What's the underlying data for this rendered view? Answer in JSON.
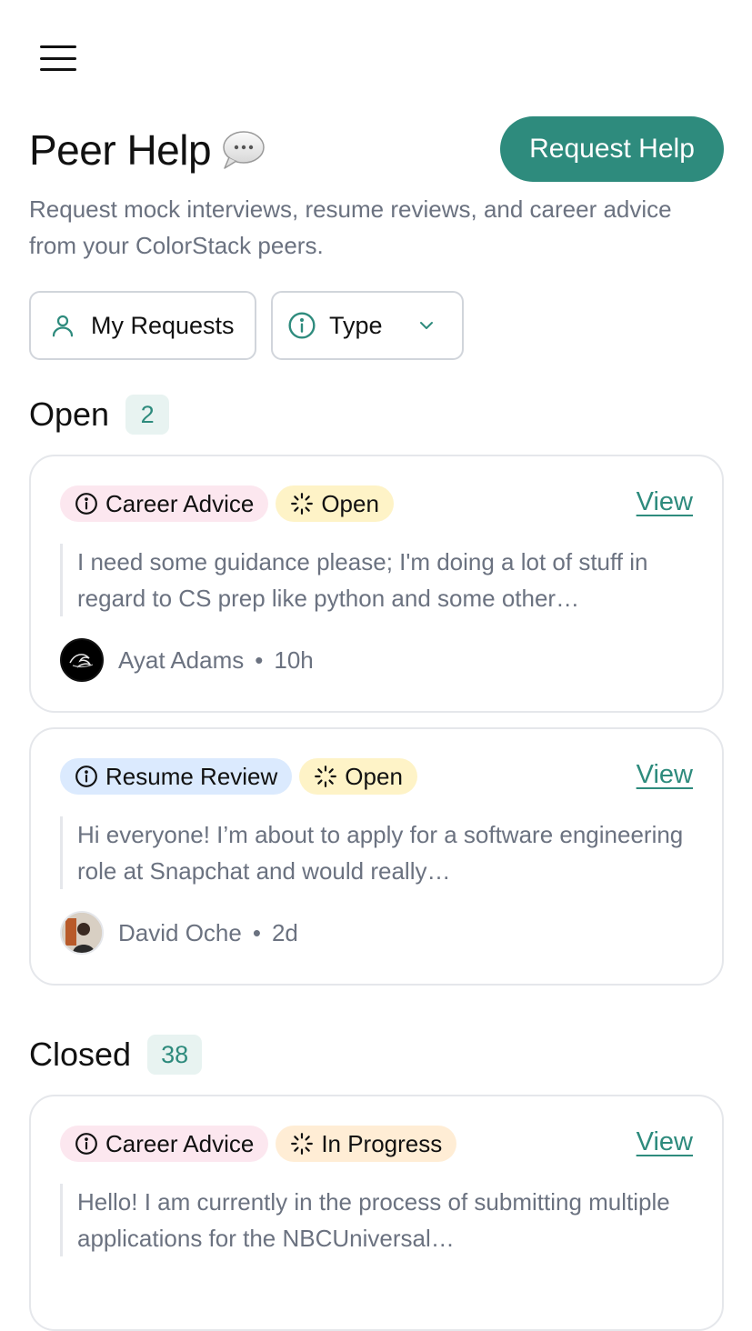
{
  "header": {
    "title": "Peer Help",
    "request_button": "Request Help",
    "subtitle": "Request mock interviews, resume reviews, and career advice from your ColorStack peers."
  },
  "filters": {
    "my_requests": "My Requests",
    "type": "Type"
  },
  "sections": {
    "open": {
      "title": "Open",
      "count": "2"
    },
    "closed": {
      "title": "Closed",
      "count": "38"
    }
  },
  "cards": [
    {
      "type_tag": "Career Advice",
      "status_tag": "Open",
      "view_label": "View",
      "description": "I need some guidance please; I'm doing a lot of stuff in regard to CS prep like python and some other…",
      "author": "Ayat Adams",
      "separator": "•",
      "time": "10h"
    },
    {
      "type_tag": "Resume Review",
      "status_tag": "Open",
      "view_label": "View",
      "description": "Hi everyone! I’m about to apply for a software engineering role at Snapchat and would really…",
      "author": "David Oche",
      "separator": "•",
      "time": "2d"
    },
    {
      "type_tag": "Career Advice",
      "status_tag": "In Progress",
      "view_label": "View",
      "description": "Hello! I am currently in the process of submitting multiple applications for the NBCUniversal…"
    }
  ],
  "colors": {
    "accent": "#2e8b7d",
    "tag_career": "#fce7ef",
    "tag_resume": "#dbeafe",
    "tag_open": "#fef3c7",
    "tag_in_progress": "#ffedd5"
  },
  "icons": {
    "menu": "hamburger-menu-icon",
    "title": "speech-bubble-icon",
    "my_requests": "user-icon",
    "type": "info-circle-icon",
    "dropdown": "chevron-down-icon",
    "tag_type": "info-circle-icon",
    "tag_status": "loader-icon"
  }
}
